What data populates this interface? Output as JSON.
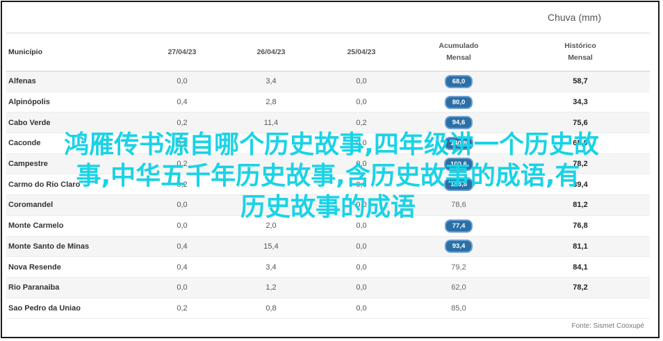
{
  "title": "Chuva (mm)",
  "columns": {
    "municipio": "Município",
    "d1": "27/04/23",
    "d2": "26/04/23",
    "d3": "25/04/23",
    "acum_l1": "Acumulado",
    "acum_l2": "Mensal",
    "hist_l1": "Histórico",
    "hist_l2": "Mensal"
  },
  "rows": [
    {
      "name": "Alfenas",
      "d1": "0,0",
      "d2": "3,4",
      "d3": "0,0",
      "acum": "68,0",
      "pill": true,
      "hist": "58,7"
    },
    {
      "name": "Alpinópolis",
      "d1": "0,4",
      "d2": "2,8",
      "d3": "0,0",
      "acum": "80,0",
      "pill": true,
      "hist": "34,3"
    },
    {
      "name": "Cabo Verde",
      "d1": "0,2",
      "d2": "11,4",
      "d3": "0,2",
      "acum": "94,6",
      "pill": true,
      "hist": "75,6"
    },
    {
      "name": "Caconde",
      "d1": "0,2",
      "d2": "",
      "d3": "0,0",
      "acum": "140,8",
      "pill": true,
      "hist": "68,0"
    },
    {
      "name": "Campestre",
      "d1": "0,2",
      "d2": "",
      "d3": "0,0",
      "acum": "100,6",
      "pill": true,
      "hist": "78,2"
    },
    {
      "name": "Carmo do Rio Claro",
      "d1": "0,2",
      "d2": "",
      "d3": "0,0",
      "acum": "145,8",
      "pill": true,
      "hist": "89,4"
    },
    {
      "name": "Coromandel",
      "d1": "0,0",
      "d2": "",
      "d3": "0,0",
      "acum": "78,6",
      "pill": false,
      "hist": "81,2"
    },
    {
      "name": "Monte Carmelo",
      "d1": "0,0",
      "d2": "2,0",
      "d3": "0,0",
      "acum": "77,4",
      "pill": true,
      "hist": "76,8"
    },
    {
      "name": "Monte Santo de Minas",
      "d1": "0,4",
      "d2": "15,4",
      "d3": "0,0",
      "acum": "93,4",
      "pill": true,
      "hist": "81,1"
    },
    {
      "name": "Nova Resende",
      "d1": "0,4",
      "d2": "3,4",
      "d3": "0,0",
      "acum": "79,2",
      "pill": false,
      "hist": "84,1"
    },
    {
      "name": "Rio Paranaiba",
      "d1": "0,0",
      "d2": "1,2",
      "d3": "0,0",
      "acum": "62,0",
      "pill": false,
      "hist": "78,2"
    },
    {
      "name": "Sao Pedro da Uniao",
      "d1": "0,2",
      "d2": "0,8",
      "d3": "0,0",
      "acum": "85,0",
      "pill": false,
      "hist": ""
    }
  ],
  "source": "Fonte: Sismet Cooxupé",
  "overlay": {
    "line1": "鸿雁传书源自哪个历史故事,四年级讲一个历史故",
    "line2": "事,中华五千年历史故事,含历史故事的成语,有",
    "line3": "历史故事的成语"
  },
  "colors": {
    "pill": "#2a6fa6",
    "overlay": "#19d3e6"
  }
}
